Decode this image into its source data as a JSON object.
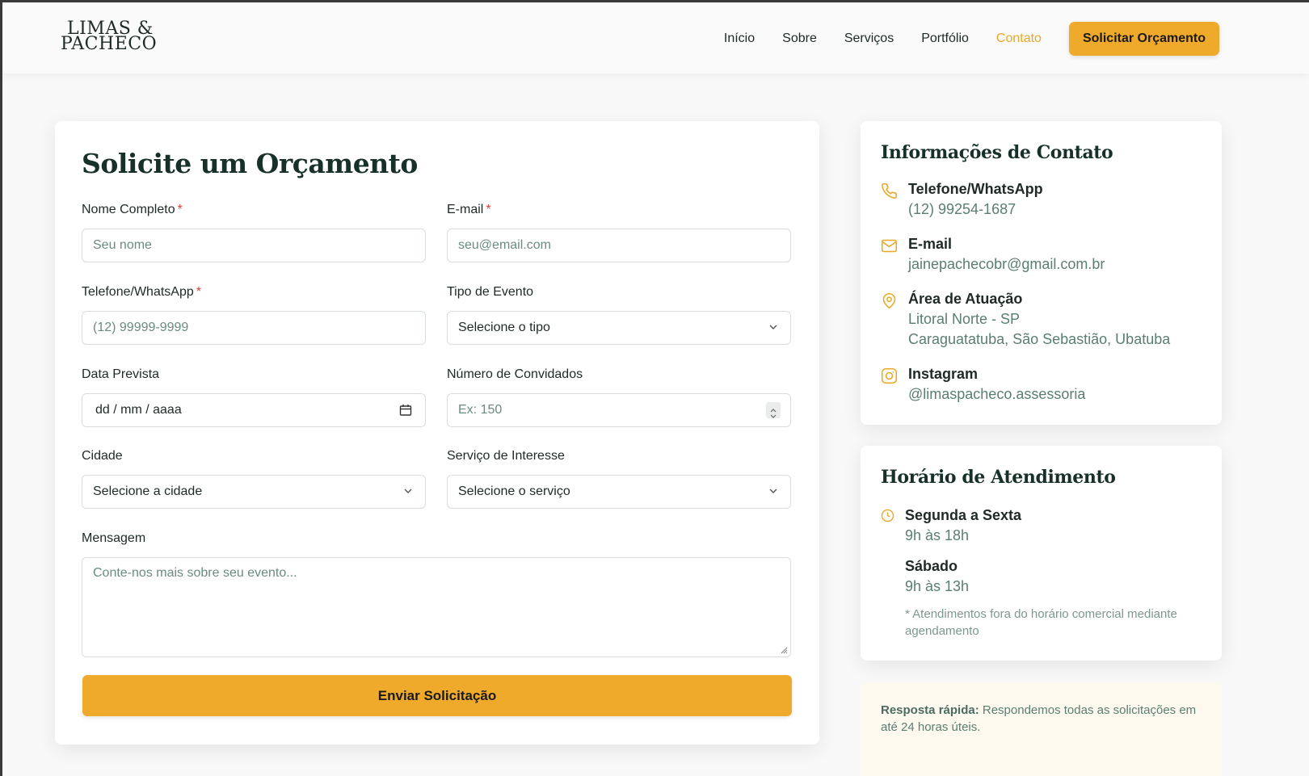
{
  "header": {
    "logo_line1": "LIMAS &",
    "logo_line2": "PACHECO",
    "nav": [
      "Início",
      "Sobre",
      "Serviços",
      "Portfólio",
      "Contato"
    ],
    "active_nav": "Contato",
    "cta": "Solicitar Orçamento"
  },
  "form": {
    "title": "Solicite um Orçamento",
    "required_mark": "*",
    "name": {
      "label": "Nome Completo",
      "placeholder": "Seu nome"
    },
    "email": {
      "label": "E-mail",
      "placeholder": "seu@email.com"
    },
    "phone": {
      "label": "Telefone/WhatsApp",
      "placeholder": "(12) 99999-9999"
    },
    "event_type": {
      "label": "Tipo de Evento",
      "value": "Selecione o tipo"
    },
    "date": {
      "label": "Data Prevista",
      "value": "dd / mm / aaaa"
    },
    "guests": {
      "label": "Número de Convidados",
      "placeholder": "Ex: 150"
    },
    "city": {
      "label": "Cidade",
      "value": "Selecione a cidade"
    },
    "service": {
      "label": "Serviço de Interesse",
      "value": "Selecione o serviço"
    },
    "message": {
      "label": "Mensagem",
      "placeholder": "Conte-nos mais sobre seu evento..."
    },
    "submit": "Enviar Solicitação"
  },
  "contact": {
    "title": "Informações de Contato",
    "phone": {
      "title": "Telefone/WhatsApp",
      "value": "(12) 99254-1687"
    },
    "email": {
      "title": "E-mail",
      "value": "jainepachecobr@gmail.com.br"
    },
    "area": {
      "title": "Área de Atuação",
      "line1": "Litoral Norte - SP",
      "line2": "Caraguatatuba, São Sebastião, Ubatuba"
    },
    "instagram": {
      "title": "Instagram",
      "value": "@limaspacheco.assessoria"
    }
  },
  "hours": {
    "title": "Horário de Atendimento",
    "weekday": {
      "title": "Segunda a Sexta",
      "value": "9h às 18h"
    },
    "saturday": {
      "title": "Sábado",
      "value": "9h às 13h"
    },
    "note": "* Atendimentos fora do horário comercial mediante agendamento"
  },
  "quick": {
    "bold": "Resposta rápida:",
    "text": " Respondemos todas as solicitações em até 24 horas úteis."
  },
  "colors": {
    "accent": "#efaa2b",
    "heading": "#18302a",
    "muted": "#5a7e72",
    "required": "#e0403c"
  }
}
